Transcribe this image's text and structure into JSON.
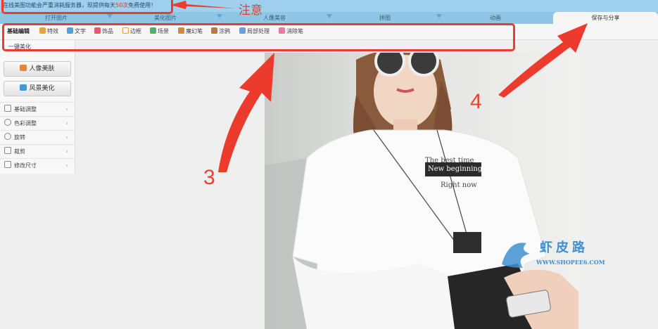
{
  "notice": {
    "prefix": "在线美图功能会严重消耗服务器，现提供每天",
    "highlight": "50次",
    "suffix": "免费使用！",
    "annotation": "注意"
  },
  "nav_tabs": [
    "打开图片",
    "美化图片",
    "人像美容",
    "拼图",
    "动画",
    "保存与分享"
  ],
  "tools": [
    {
      "label": "基础编辑",
      "icon": "",
      "color": ""
    },
    {
      "label": "特效",
      "icon": "magic-icon",
      "color": "#e8a33a"
    },
    {
      "label": "文字",
      "icon": "text-icon",
      "color": "#4aa3df"
    },
    {
      "label": "饰品",
      "icon": "bow-icon",
      "color": "#e55b6e"
    },
    {
      "label": "边框",
      "icon": "frame-icon",
      "color": "#f0a020"
    },
    {
      "label": "场景",
      "icon": "scene-icon",
      "color": "#56b06b"
    },
    {
      "label": "魔幻笔",
      "icon": "pen-icon",
      "color": "#d28a3c"
    },
    {
      "label": "涂鸦",
      "icon": "brush-icon",
      "color": "#b87844"
    },
    {
      "label": "局部处理",
      "icon": "local-icon",
      "color": "#6b9fd8"
    },
    {
      "label": "消除笔",
      "icon": "eraser-icon",
      "color": "#e07f9a"
    }
  ],
  "sidebar": {
    "head": "一键美化",
    "buttons": [
      {
        "label": "人像美肤",
        "icon": "portrait-icon",
        "color": "#e7843a"
      },
      {
        "label": "风景美化",
        "icon": "landscape-icon",
        "color": "#3f9ad6"
      }
    ],
    "items": [
      {
        "label": "基础调整",
        "icon": "sliders-icon"
      },
      {
        "label": "色彩调整",
        "icon": "palette-icon"
      },
      {
        "label": "旋转",
        "icon": "rotate-icon"
      },
      {
        "label": "裁剪",
        "icon": "crop-icon"
      },
      {
        "label": "修改尺寸",
        "icon": "resize-icon"
      }
    ]
  },
  "photo": {
    "shirt_line1": "The best time",
    "shirt_line2": "New beginning",
    "shirt_line3": "Right now"
  },
  "annotations": {
    "n3": "3",
    "n4": "4"
  },
  "watermark": {
    "cn": "虾皮路",
    "url": "WWW.SHOPEE6.COM"
  },
  "colors": {
    "accent_red": "#ec3b2c",
    "nav_blue": "#8fc6e6",
    "topbar_blue": "#9fd0ee"
  }
}
